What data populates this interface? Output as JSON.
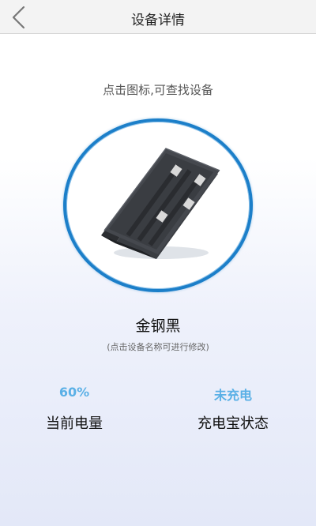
{
  "header": {
    "title": "设备详情"
  },
  "hint": "点击图标,可查找设备",
  "device": {
    "name": "金钢黑",
    "rename_hint": "(点击设备名称可进行修改)"
  },
  "stats": {
    "battery_value": "60%",
    "battery_label": "当前电量",
    "status_value": "未充电",
    "status_label": "充电宝状态"
  },
  "colors": {
    "accent": "#1c7fc9",
    "stat_value": "#5ab0e6",
    "header_bg": "#f3f3f3"
  }
}
